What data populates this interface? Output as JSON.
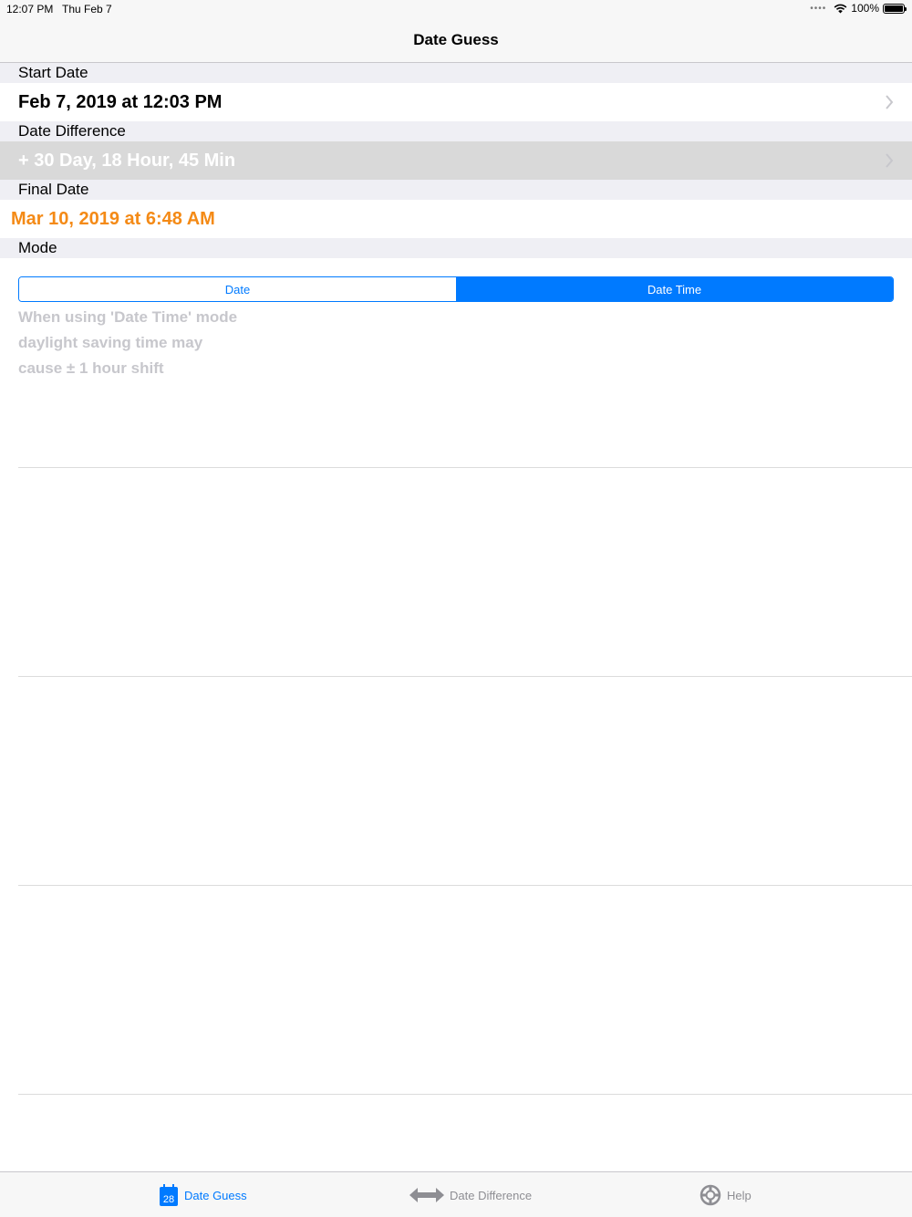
{
  "status": {
    "time": "12:07 PM",
    "date": "Thu Feb 7",
    "battery": "100%"
  },
  "nav": {
    "title": "Date Guess"
  },
  "sections": {
    "start_header": "Start Date",
    "start_value": "Feb 7, 2019 at 12:03 PM",
    "diff_header": "Date Difference",
    "diff_value": "+ 30 Day, 18 Hour, 45 Min",
    "final_header": "Final Date",
    "final_value": "Mar 10, 2019 at 6:48 AM",
    "mode_header": "Mode"
  },
  "mode": {
    "options": [
      "Date",
      "Date Time"
    ],
    "selected": "Date Time"
  },
  "note": {
    "line1": "When using  'Date Time' mode",
    "line2": "daylight saving time may",
    "line3": "cause ± 1 hour shift"
  },
  "tabs": [
    {
      "label": "Date Guess",
      "icon": "calendar-icon",
      "icon_text": "28",
      "active": true
    },
    {
      "label": "Date Difference",
      "icon": "double-arrow-icon",
      "active": false
    },
    {
      "label": "Help",
      "icon": "lifebuoy-icon",
      "active": false
    }
  ],
  "colors": {
    "accent": "#007aff",
    "final_date": "#f48a16",
    "selected_row": "#d9d9d9",
    "section_bg": "#efeff4"
  }
}
